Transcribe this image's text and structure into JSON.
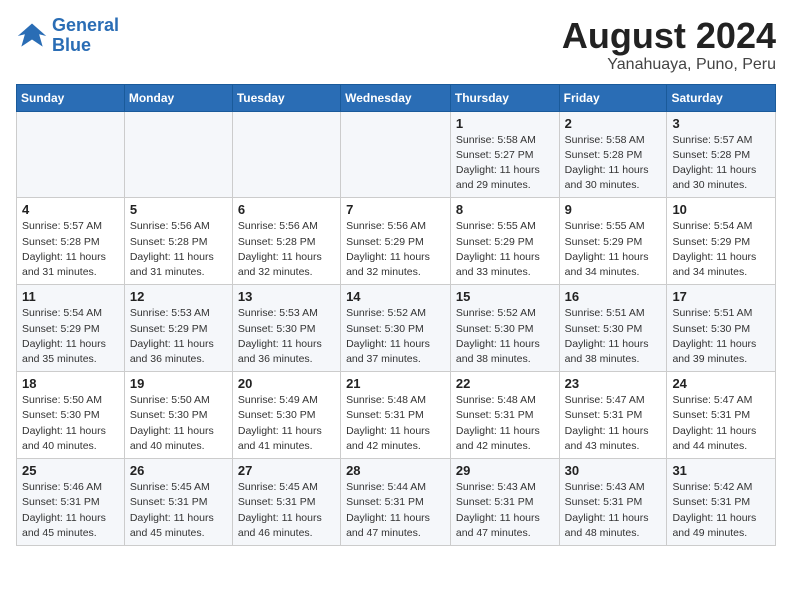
{
  "logo": {
    "line1": "General",
    "line2": "Blue"
  },
  "title": "August 2024",
  "subtitle": "Yanahuaya, Puno, Peru",
  "weekdays": [
    "Sunday",
    "Monday",
    "Tuesday",
    "Wednesday",
    "Thursday",
    "Friday",
    "Saturday"
  ],
  "weeks": [
    [
      {
        "day": "",
        "sunrise": "",
        "sunset": "",
        "daylight": ""
      },
      {
        "day": "",
        "sunrise": "",
        "sunset": "",
        "daylight": ""
      },
      {
        "day": "",
        "sunrise": "",
        "sunset": "",
        "daylight": ""
      },
      {
        "day": "",
        "sunrise": "",
        "sunset": "",
        "daylight": ""
      },
      {
        "day": "1",
        "sunrise": "Sunrise: 5:58 AM",
        "sunset": "Sunset: 5:27 PM",
        "daylight": "Daylight: 11 hours and 29 minutes."
      },
      {
        "day": "2",
        "sunrise": "Sunrise: 5:58 AM",
        "sunset": "Sunset: 5:28 PM",
        "daylight": "Daylight: 11 hours and 30 minutes."
      },
      {
        "day": "3",
        "sunrise": "Sunrise: 5:57 AM",
        "sunset": "Sunset: 5:28 PM",
        "daylight": "Daylight: 11 hours and 30 minutes."
      }
    ],
    [
      {
        "day": "4",
        "sunrise": "Sunrise: 5:57 AM",
        "sunset": "Sunset: 5:28 PM",
        "daylight": "Daylight: 11 hours and 31 minutes."
      },
      {
        "day": "5",
        "sunrise": "Sunrise: 5:56 AM",
        "sunset": "Sunset: 5:28 PM",
        "daylight": "Daylight: 11 hours and 31 minutes."
      },
      {
        "day": "6",
        "sunrise": "Sunrise: 5:56 AM",
        "sunset": "Sunset: 5:28 PM",
        "daylight": "Daylight: 11 hours and 32 minutes."
      },
      {
        "day": "7",
        "sunrise": "Sunrise: 5:56 AM",
        "sunset": "Sunset: 5:29 PM",
        "daylight": "Daylight: 11 hours and 32 minutes."
      },
      {
        "day": "8",
        "sunrise": "Sunrise: 5:55 AM",
        "sunset": "Sunset: 5:29 PM",
        "daylight": "Daylight: 11 hours and 33 minutes."
      },
      {
        "day": "9",
        "sunrise": "Sunrise: 5:55 AM",
        "sunset": "Sunset: 5:29 PM",
        "daylight": "Daylight: 11 hours and 34 minutes."
      },
      {
        "day": "10",
        "sunrise": "Sunrise: 5:54 AM",
        "sunset": "Sunset: 5:29 PM",
        "daylight": "Daylight: 11 hours and 34 minutes."
      }
    ],
    [
      {
        "day": "11",
        "sunrise": "Sunrise: 5:54 AM",
        "sunset": "Sunset: 5:29 PM",
        "daylight": "Daylight: 11 hours and 35 minutes."
      },
      {
        "day": "12",
        "sunrise": "Sunrise: 5:53 AM",
        "sunset": "Sunset: 5:29 PM",
        "daylight": "Daylight: 11 hours and 36 minutes."
      },
      {
        "day": "13",
        "sunrise": "Sunrise: 5:53 AM",
        "sunset": "Sunset: 5:30 PM",
        "daylight": "Daylight: 11 hours and 36 minutes."
      },
      {
        "day": "14",
        "sunrise": "Sunrise: 5:52 AM",
        "sunset": "Sunset: 5:30 PM",
        "daylight": "Daylight: 11 hours and 37 minutes."
      },
      {
        "day": "15",
        "sunrise": "Sunrise: 5:52 AM",
        "sunset": "Sunset: 5:30 PM",
        "daylight": "Daylight: 11 hours and 38 minutes."
      },
      {
        "day": "16",
        "sunrise": "Sunrise: 5:51 AM",
        "sunset": "Sunset: 5:30 PM",
        "daylight": "Daylight: 11 hours and 38 minutes."
      },
      {
        "day": "17",
        "sunrise": "Sunrise: 5:51 AM",
        "sunset": "Sunset: 5:30 PM",
        "daylight": "Daylight: 11 hours and 39 minutes."
      }
    ],
    [
      {
        "day": "18",
        "sunrise": "Sunrise: 5:50 AM",
        "sunset": "Sunset: 5:30 PM",
        "daylight": "Daylight: 11 hours and 40 minutes."
      },
      {
        "day": "19",
        "sunrise": "Sunrise: 5:50 AM",
        "sunset": "Sunset: 5:30 PM",
        "daylight": "Daylight: 11 hours and 40 minutes."
      },
      {
        "day": "20",
        "sunrise": "Sunrise: 5:49 AM",
        "sunset": "Sunset: 5:30 PM",
        "daylight": "Daylight: 11 hours and 41 minutes."
      },
      {
        "day": "21",
        "sunrise": "Sunrise: 5:48 AM",
        "sunset": "Sunset: 5:31 PM",
        "daylight": "Daylight: 11 hours and 42 minutes."
      },
      {
        "day": "22",
        "sunrise": "Sunrise: 5:48 AM",
        "sunset": "Sunset: 5:31 PM",
        "daylight": "Daylight: 11 hours and 42 minutes."
      },
      {
        "day": "23",
        "sunrise": "Sunrise: 5:47 AM",
        "sunset": "Sunset: 5:31 PM",
        "daylight": "Daylight: 11 hours and 43 minutes."
      },
      {
        "day": "24",
        "sunrise": "Sunrise: 5:47 AM",
        "sunset": "Sunset: 5:31 PM",
        "daylight": "Daylight: 11 hours and 44 minutes."
      }
    ],
    [
      {
        "day": "25",
        "sunrise": "Sunrise: 5:46 AM",
        "sunset": "Sunset: 5:31 PM",
        "daylight": "Daylight: 11 hours and 45 minutes."
      },
      {
        "day": "26",
        "sunrise": "Sunrise: 5:45 AM",
        "sunset": "Sunset: 5:31 PM",
        "daylight": "Daylight: 11 hours and 45 minutes."
      },
      {
        "day": "27",
        "sunrise": "Sunrise: 5:45 AM",
        "sunset": "Sunset: 5:31 PM",
        "daylight": "Daylight: 11 hours and 46 minutes."
      },
      {
        "day": "28",
        "sunrise": "Sunrise: 5:44 AM",
        "sunset": "Sunset: 5:31 PM",
        "daylight": "Daylight: 11 hours and 47 minutes."
      },
      {
        "day": "29",
        "sunrise": "Sunrise: 5:43 AM",
        "sunset": "Sunset: 5:31 PM",
        "daylight": "Daylight: 11 hours and 47 minutes."
      },
      {
        "day": "30",
        "sunrise": "Sunrise: 5:43 AM",
        "sunset": "Sunset: 5:31 PM",
        "daylight": "Daylight: 11 hours and 48 minutes."
      },
      {
        "day": "31",
        "sunrise": "Sunrise: 5:42 AM",
        "sunset": "Sunset: 5:31 PM",
        "daylight": "Daylight: 11 hours and 49 minutes."
      }
    ]
  ]
}
